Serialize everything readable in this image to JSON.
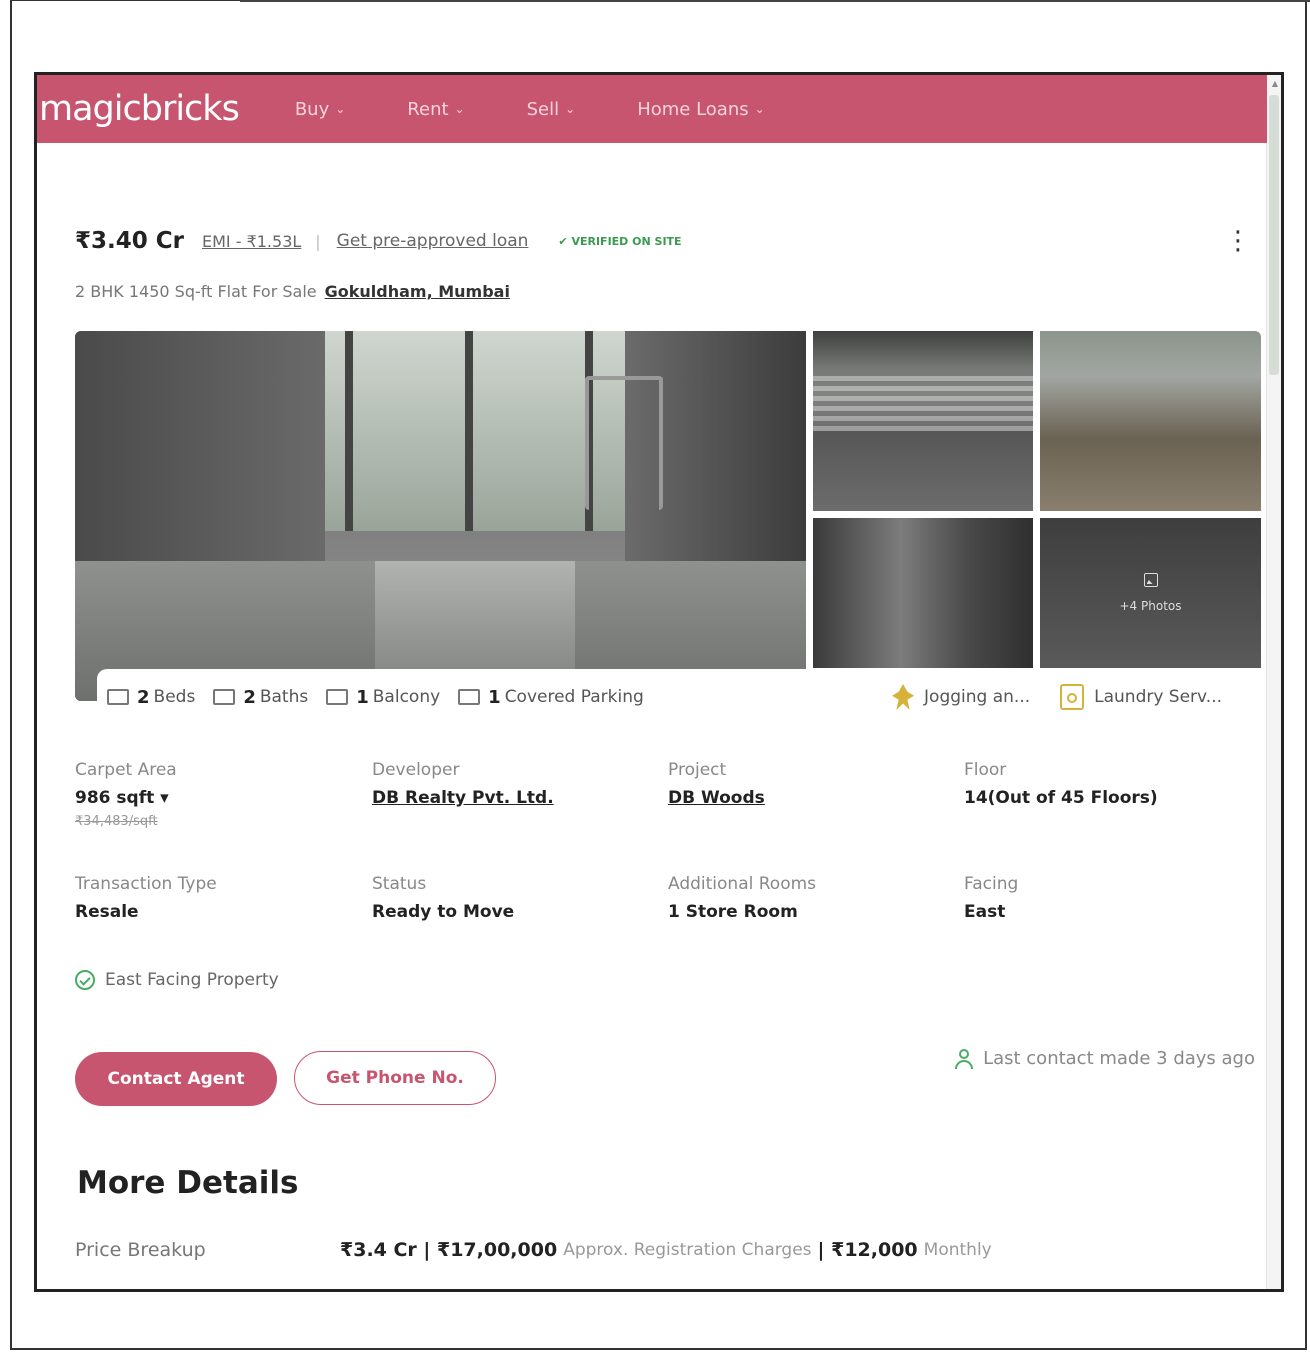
{
  "nav": {
    "logo": "magicbricks",
    "items": [
      {
        "label": "Buy"
      },
      {
        "label": "Rent"
      },
      {
        "label": "Sell"
      },
      {
        "label": "Home Loans"
      }
    ]
  },
  "header": {
    "price": "₹3.40 Cr",
    "emi": "EMI - ₹1.53L",
    "loan_link": "Get pre-approved loan",
    "verified": "VERIFIED ON SITE",
    "subtitle": "2 BHK 1450 Sq-ft Flat For Sale",
    "location": "Gokuldham, Mumbai"
  },
  "gallery": {
    "more_photos": "+4 Photos"
  },
  "amenities": {
    "beds_num": "2",
    "beds_label": "Beds",
    "baths_num": "2",
    "baths_label": "Baths",
    "balcony_num": "1",
    "balcony_label": "Balcony",
    "parking_num": "1",
    "parking_label": "Covered Parking",
    "jogging": "Jogging an...",
    "laundry": "Laundry Serv..."
  },
  "details": {
    "carpet_label": "Carpet Area",
    "carpet_value": "986 sqft",
    "carpet_sub": "₹34,483/sqft",
    "developer_label": "Developer",
    "developer_value": "DB Realty Pvt. Ltd.",
    "project_label": "Project",
    "project_value": "DB Woods",
    "floor_label": "Floor",
    "floor_value": "14(Out of 45 Floors)",
    "transaction_label": "Transaction Type",
    "transaction_value": "Resale",
    "status_label": "Status",
    "status_value": "Ready to Move",
    "rooms_label": "Additional Rooms",
    "rooms_value": "1 Store Room",
    "facing_label": "Facing",
    "facing_value": "East"
  },
  "tag": "East Facing Property",
  "actions": {
    "contact": "Contact Agent",
    "phone": "Get Phone No.",
    "last_contact": "Last contact made 3 days ago"
  },
  "more": {
    "title": "More Details",
    "breakup_label": "Price Breakup",
    "breakup_price": "₹3.4 Cr",
    "breakup_reg": "₹17,00,000",
    "breakup_reg_note": "Approx. Registration Charges",
    "breakup_monthly": "₹12,000",
    "breakup_monthly_note": "Monthly"
  }
}
